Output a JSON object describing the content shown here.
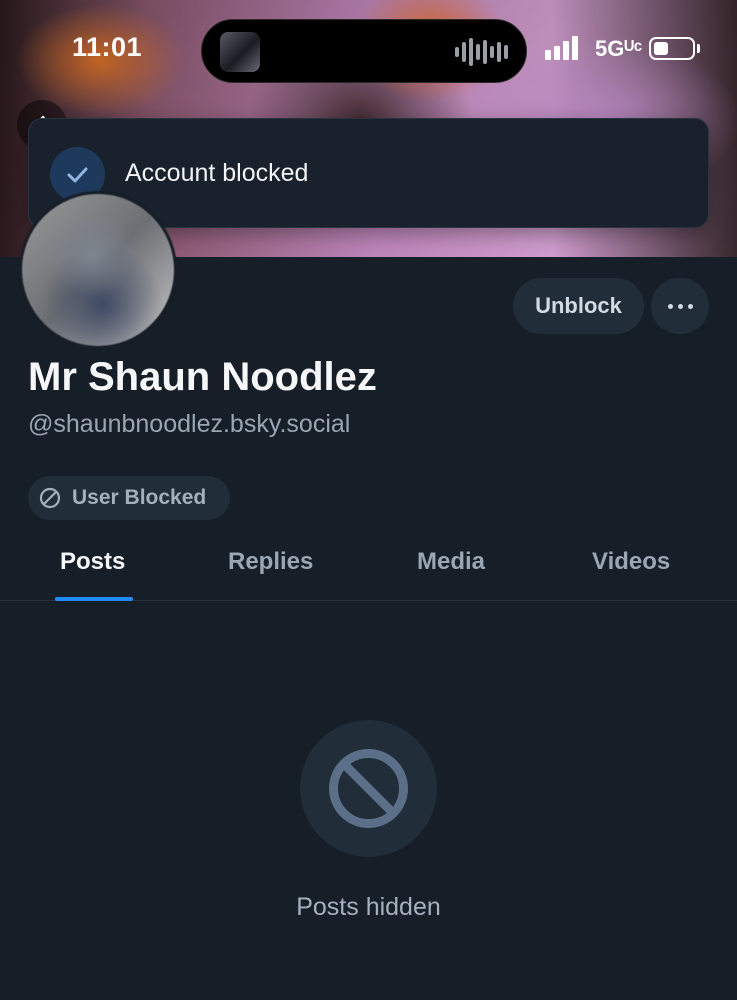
{
  "status_bar": {
    "time": "11:01",
    "network": "5Gᵁᶜ"
  },
  "toast": {
    "message": "Account blocked"
  },
  "profile": {
    "display_name": "Mr Shaun Noodlez",
    "handle": "@shaunbnoodlez.bsky.social",
    "blocked_label": "User Blocked"
  },
  "actions": {
    "unblock_label": "Unblock"
  },
  "tabs": [
    {
      "label": "Posts",
      "active": true
    },
    {
      "label": "Replies",
      "active": false
    },
    {
      "label": "Media",
      "active": false
    },
    {
      "label": "Videos",
      "active": false
    }
  ],
  "content": {
    "hidden_message": "Posts hidden"
  },
  "colors": {
    "background": "#161e27",
    "accent": "#208bfe",
    "pill_bg": "#212d39",
    "muted_text": "#9aa6b3"
  }
}
